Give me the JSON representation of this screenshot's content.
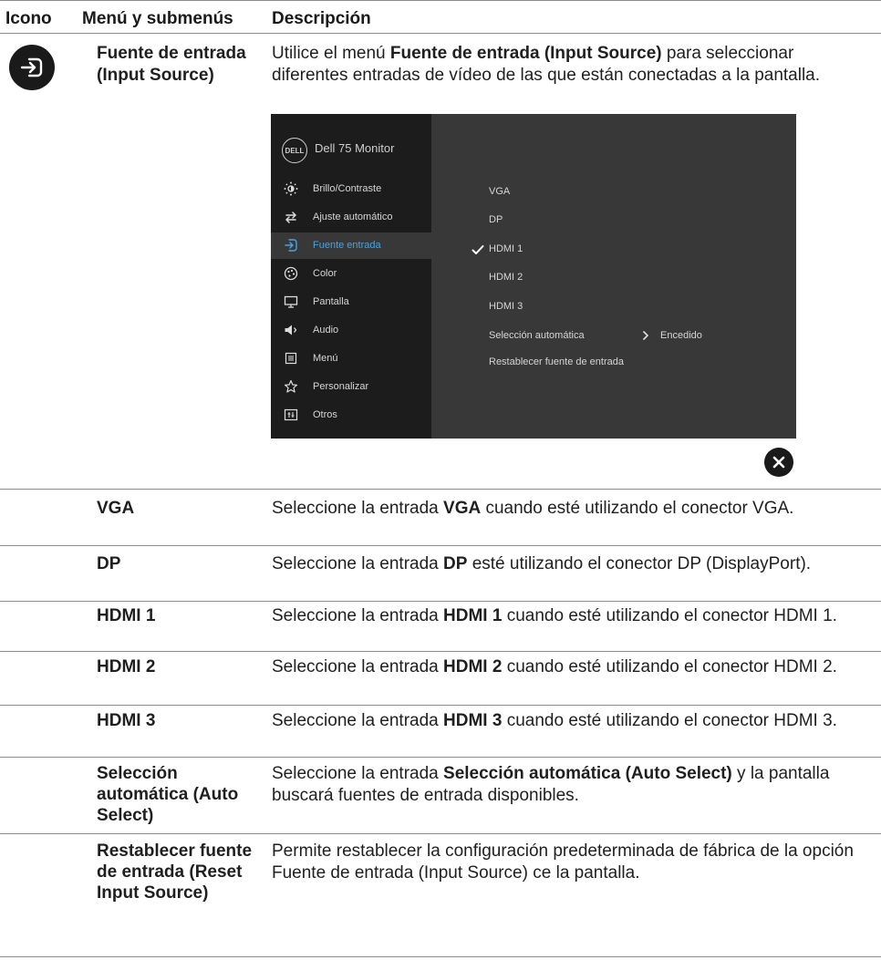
{
  "headers": {
    "icon": "Icono",
    "menu": "Menú y submenús",
    "desc": "Descripción"
  },
  "main": {
    "icon_name": "input-source-icon",
    "menu_name": "Fuente de entrada (Input Source)",
    "desc_pre": "Utilice el menú ",
    "desc_bold": "Fuente de entrada (Input Source)",
    "desc_post": " para seleccionar diferentes entradas de vídeo de las que están conectadas a la pantalla."
  },
  "osd": {
    "logo": "DELL",
    "model": "Dell 75 Monitor",
    "menu_items": [
      {
        "label": "Brillo/Contraste",
        "icon": "brightness-icon"
      },
      {
        "label": "Ajuste automático",
        "icon": "auto-adjust-icon"
      },
      {
        "label": "Fuente entrada",
        "icon": "input-source-icon"
      },
      {
        "label": "Color",
        "icon": "palette-icon"
      },
      {
        "label": "Pantalla",
        "icon": "display-icon"
      },
      {
        "label": "Audio",
        "icon": "speaker-icon"
      },
      {
        "label": "Menú",
        "icon": "menu-icon"
      },
      {
        "label": "Personalizar",
        "icon": "star-icon"
      },
      {
        "label": "Otros",
        "icon": "others-icon"
      }
    ],
    "active_index": 2,
    "options": [
      "VGA",
      "DP",
      "HDMI 1",
      "HDMI 2",
      "HDMI 3",
      "Selección automática",
      "Restablecer fuente de entrada"
    ],
    "selected_option": "HDMI 1",
    "auto_select_value": "Encedido",
    "accent_color": "#4aa3df"
  },
  "rows": [
    {
      "name": "VGA",
      "pre": "Seleccione la entrada ",
      "bold": "VGA",
      "post": " cuando esté utilizando el conector VGA."
    },
    {
      "name": "DP",
      "pre": "Seleccione la entrada ",
      "bold": "DP",
      "post": " esté utilizando el conector DP (DisplayPort)."
    },
    {
      "name": "HDMI 1",
      "pre": "Seleccione la entrada ",
      "bold": "HDMI 1",
      "post": " cuando esté utilizando el conector HDMI 1."
    },
    {
      "name": "HDMI 2",
      "pre": "Seleccione la entrada ",
      "bold": "HDMI 2",
      "post": " cuando esté utilizando el conector HDMI 2."
    },
    {
      "name": "HDMI 3",
      "pre": "Seleccione la entrada ",
      "bold": "HDMI 3",
      "post": " cuando esté utilizando el conector HDMI 3."
    },
    {
      "name": "Selección automática (Auto Select)",
      "pre": "Seleccione la entrada ",
      "bold": "Selección automática (Auto Select)",
      "post": " y la pantalla buscará fuentes de entrada disponibles."
    },
    {
      "name": "Restablecer fuente de entrada (Reset Input Source)",
      "pre": "Permite restablecer la configuración predeterminada de fábrica de la opción ",
      "bold": "",
      "mid": "Fuente de entrada (Input Source)",
      "post": " ce la pantalla."
    }
  ]
}
